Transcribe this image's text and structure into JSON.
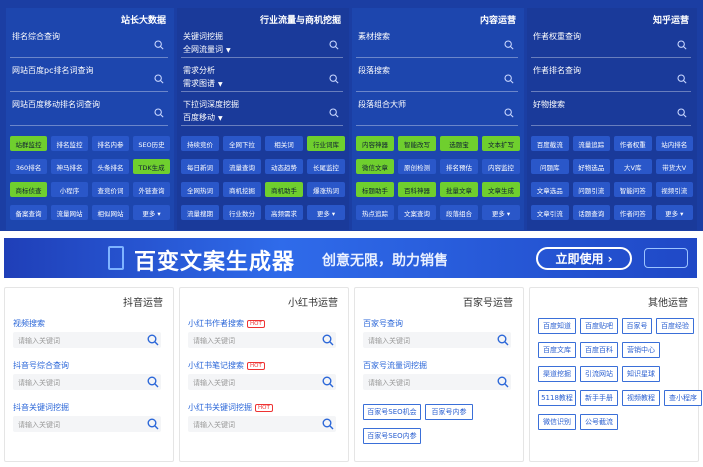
{
  "panels": [
    {
      "title": "站长大数据",
      "fields": [
        {
          "label": "排名综合查询",
          "sub": ""
        },
        {
          "label": "网站百度pc排名词查询",
          "sub": ""
        },
        {
          "label": "网站百度移动排名词查询",
          "sub": ""
        }
      ],
      "buttons": [
        [
          {
            "t": "站群监控",
            "g": true
          },
          {
            "t": "排名监控",
            "g": false
          },
          {
            "t": "排名内参",
            "g": false
          },
          {
            "t": "SEO历史",
            "g": false
          }
        ],
        [
          {
            "t": "360排名",
            "g": false
          },
          {
            "t": "神马排名",
            "g": false
          },
          {
            "t": "头条排名",
            "g": false
          },
          {
            "t": "TDK生成",
            "g": true
          }
        ],
        [
          {
            "t": "商标侦查",
            "g": true
          },
          {
            "t": "小程序",
            "g": false
          },
          {
            "t": "查竞价词",
            "g": false
          },
          {
            "t": "外链查询",
            "g": false
          }
        ],
        [
          {
            "t": "备案查询",
            "g": false
          },
          {
            "t": "流量网站",
            "g": false
          },
          {
            "t": "相似网站",
            "g": false
          },
          {
            "t": "更多 ▾",
            "g": false
          }
        ]
      ]
    },
    {
      "title": "行业流量与商机挖掘",
      "fields": [
        {
          "label": "关键词挖掘",
          "sub": "全网流量词"
        },
        {
          "label": "需求分析",
          "sub": "需求图谱"
        },
        {
          "label": "下拉词深度挖掘",
          "sub": "百度移动"
        }
      ],
      "buttons": [
        [
          {
            "t": "持续竞价",
            "g": false
          },
          {
            "t": "全网下拉",
            "g": false
          },
          {
            "t": "相关词",
            "g": false
          },
          {
            "t": "行业词库",
            "g": true
          }
        ],
        [
          {
            "t": "每日新词",
            "g": false
          },
          {
            "t": "流量查询",
            "g": false
          },
          {
            "t": "动态趋势",
            "g": false
          },
          {
            "t": "长尾监控",
            "g": false
          }
        ],
        [
          {
            "t": "全网热词",
            "g": false
          },
          {
            "t": "商机挖掘",
            "g": false
          },
          {
            "t": "商机助手",
            "g": true
          },
          {
            "t": "爆涨热词",
            "g": false
          }
        ],
        [
          {
            "t": "流量搜期",
            "g": false
          },
          {
            "t": "行业数分",
            "g": false
          },
          {
            "t": "高频需求",
            "g": false
          },
          {
            "t": "更多 ▾",
            "g": false
          }
        ]
      ]
    },
    {
      "title": "内容运营",
      "fields": [
        {
          "label": "素材搜索",
          "sub": ""
        },
        {
          "label": "段落搜索",
          "sub": ""
        },
        {
          "label": "段落组合大师",
          "sub": ""
        }
      ],
      "buttons": [
        [
          {
            "t": "内容神器",
            "g": true
          },
          {
            "t": "智能改写",
            "g": true
          },
          {
            "t": "选题宝",
            "g": true
          },
          {
            "t": "文本扩写",
            "g": true
          }
        ],
        [
          {
            "t": "微信文章",
            "g": true
          },
          {
            "t": "原创检测",
            "g": false
          },
          {
            "t": "排名预估",
            "g": false
          },
          {
            "t": "内容监控",
            "g": false
          }
        ],
        [
          {
            "t": "标题助手",
            "g": true
          },
          {
            "t": "百科神器",
            "g": true
          },
          {
            "t": "批量文章",
            "g": true
          },
          {
            "t": "文章生成",
            "g": true
          }
        ],
        [
          {
            "t": "热点追踪",
            "g": false
          },
          {
            "t": "文案查询",
            "g": false
          },
          {
            "t": "段落组合",
            "g": false
          },
          {
            "t": "更多 ▾",
            "g": false
          }
        ]
      ]
    },
    {
      "title": "知乎运营",
      "fields": [
        {
          "label": "作者权重查询",
          "sub": ""
        },
        {
          "label": "作者排名查询",
          "sub": ""
        },
        {
          "label": "好物搜索",
          "sub": ""
        }
      ],
      "buttons": [
        [
          {
            "t": "百度截流",
            "g": false
          },
          {
            "t": "流量追踪",
            "g": false
          },
          {
            "t": "作者权重",
            "g": false
          },
          {
            "t": "站内排名",
            "g": false
          }
        ],
        [
          {
            "t": "问题库",
            "g": false
          },
          {
            "t": "好物选品",
            "g": false
          },
          {
            "t": "大V库",
            "g": false
          },
          {
            "t": "带货大V",
            "g": false
          }
        ],
        [
          {
            "t": "文章选品",
            "g": false
          },
          {
            "t": "问题引流",
            "g": false
          },
          {
            "t": "智能问答",
            "g": false
          },
          {
            "t": "视频引流",
            "g": false
          }
        ],
        [
          {
            "t": "文章引流",
            "g": false
          },
          {
            "t": "话题查询",
            "g": false
          },
          {
            "t": "作者问答",
            "g": false
          },
          {
            "t": "更多 ▾",
            "g": false
          }
        ]
      ]
    }
  ],
  "banner": {
    "title": "百变文案生成器",
    "subtitle": "创意无限，助力销售",
    "cta": "立即使用 ›"
  },
  "cards": {
    "douyin": {
      "title": "抖音运营",
      "items": [
        {
          "label": "视频搜索",
          "placeholder": "请输入关键词"
        },
        {
          "label": "抖音号综合查询",
          "placeholder": "请输入关键词"
        },
        {
          "label": "抖音关键词挖掘",
          "placeholder": "请输入关键词"
        }
      ]
    },
    "xhs": {
      "title": "小红书运营",
      "hot": "HOT",
      "items": [
        {
          "label": "小红书作者搜索",
          "placeholder": "请输入关键词"
        },
        {
          "label": "小红书笔记搜索",
          "placeholder": "请输入关键词"
        },
        {
          "label": "小红书关键词挖掘",
          "placeholder": "请输入关键词"
        }
      ]
    },
    "baijia": {
      "title": "百家号运营",
      "items": [
        {
          "label": "百家号查询",
          "placeholder": "请输入关键词"
        },
        {
          "label": "百家号流量词挖掘",
          "placeholder": "请输入关键词"
        }
      ],
      "tags": [
        "百家号SEO机会",
        "百家号内参",
        "百家号SEO内参"
      ]
    },
    "other": {
      "title": "其他运营",
      "tags": [
        [
          "百度知道",
          "百度贴吧",
          "百家号",
          "百度经验"
        ],
        [
          "百度文库",
          "百度百科",
          "营销中心"
        ],
        [
          "渠道挖掘",
          "引流网站",
          "知识星球"
        ],
        [
          "5118教程",
          "新手手册",
          "视频教程",
          "查小程序"
        ],
        [
          "微信识别",
          "公号截流"
        ]
      ]
    }
  }
}
